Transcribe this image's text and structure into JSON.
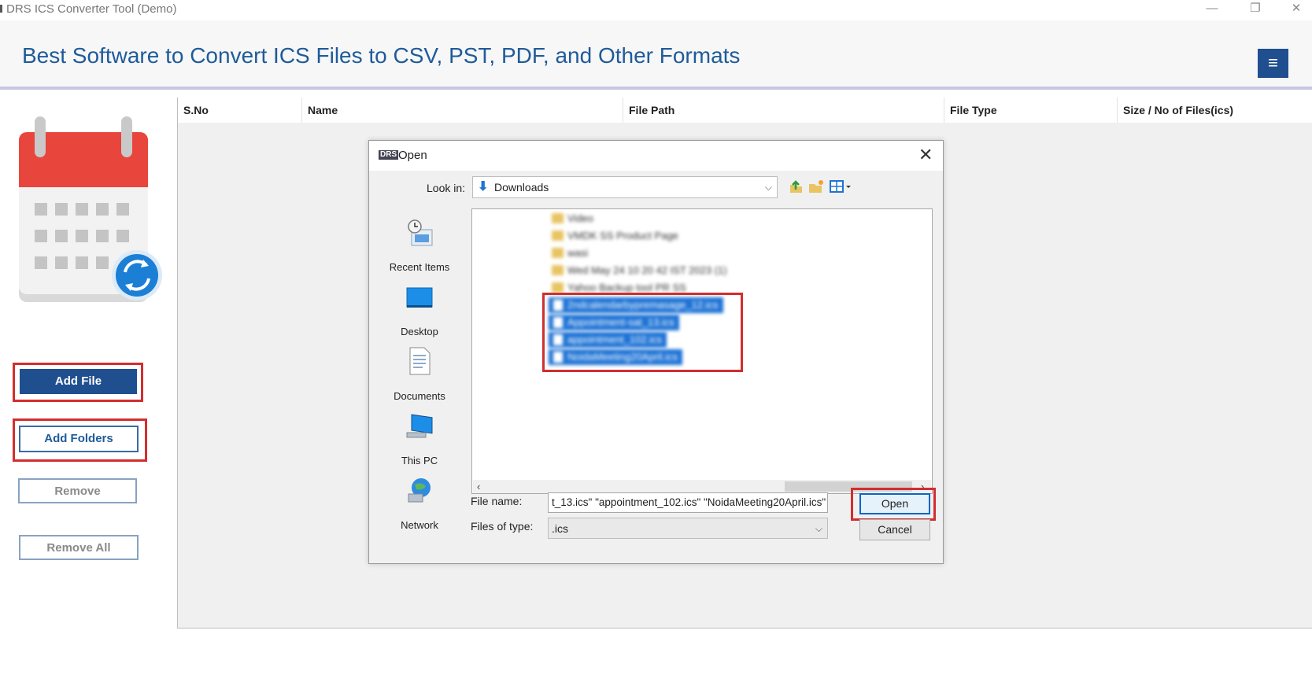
{
  "window": {
    "title": "DRS ICS Converter Tool (Demo)"
  },
  "header": {
    "heading": "Best Software to Convert ICS Files to CSV, PST, PDF, and Other Formats",
    "menu_icon": "hamburger-menu-icon",
    "accent_color": "#1f5b99"
  },
  "sidebar": {
    "add_file": "Add File",
    "add_folders": "Add Folders",
    "remove": "Remove",
    "remove_all": "Remove All"
  },
  "table": {
    "columns": [
      "S.No",
      "Name",
      "File Path",
      "File Type",
      "Size / No of Files(ics)"
    ]
  },
  "dialog": {
    "title": "Open",
    "look_in_label": "Look in:",
    "look_in_value": "Downloads",
    "places": [
      "Recent Items",
      "Desktop",
      "Documents",
      "This PC",
      "Network"
    ],
    "folders": [
      "Video",
      "VMDK SS Product Page",
      "wasi",
      "Wed May 24 10 20 42 IST 2023 (1)",
      "Yahoo Backup tool PR SS"
    ],
    "selected_files": [
      "2ndcalendarbypremasage_12.ics",
      "Appointment-sat_13.ics",
      "appointment_102.ics",
      "NoidaMeeting20April.ics"
    ],
    "file_name_label": "File name:",
    "file_name_value": "t_13.ics\" \"appointment_102.ics\" \"NoidaMeeting20April.ics\"",
    "files_of_type_label": "Files of type:",
    "files_of_type_value": ".ics",
    "open_button": "Open",
    "cancel_button": "Cancel"
  }
}
